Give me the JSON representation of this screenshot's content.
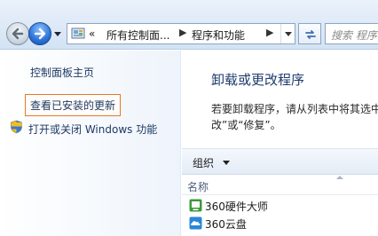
{
  "address": {
    "overflow_glyph": "«",
    "crumb1": "所有控制面...",
    "arrow1": "▶",
    "crumb2": "程序和功能",
    "arrow2": "▶"
  },
  "search": {
    "placeholder": "搜索 程序和"
  },
  "left_pane": {
    "home": "控制面板主页",
    "view_updates": "查看已安装的更新",
    "windows_features": "打开或关闭 Windows 功能"
  },
  "main": {
    "heading": "卸载或更改程序",
    "description_line1": "若要卸载程序，请从列表中将其选中",
    "description_line2": "改”或“修复”。"
  },
  "toolbar": {
    "organize": "组织"
  },
  "list": {
    "column_name": "名称",
    "items": [
      {
        "name": "360硬件大师",
        "icon": "hardware-master-icon",
        "color": "#3c9a3a"
      },
      {
        "name": "360云盘",
        "icon": "cloud-disk-icon",
        "color": "#2a86d8"
      }
    ]
  },
  "colors": {
    "highlight_border": "#e6782a",
    "heading": "#1e3c6e",
    "link": "#1e3a64"
  }
}
